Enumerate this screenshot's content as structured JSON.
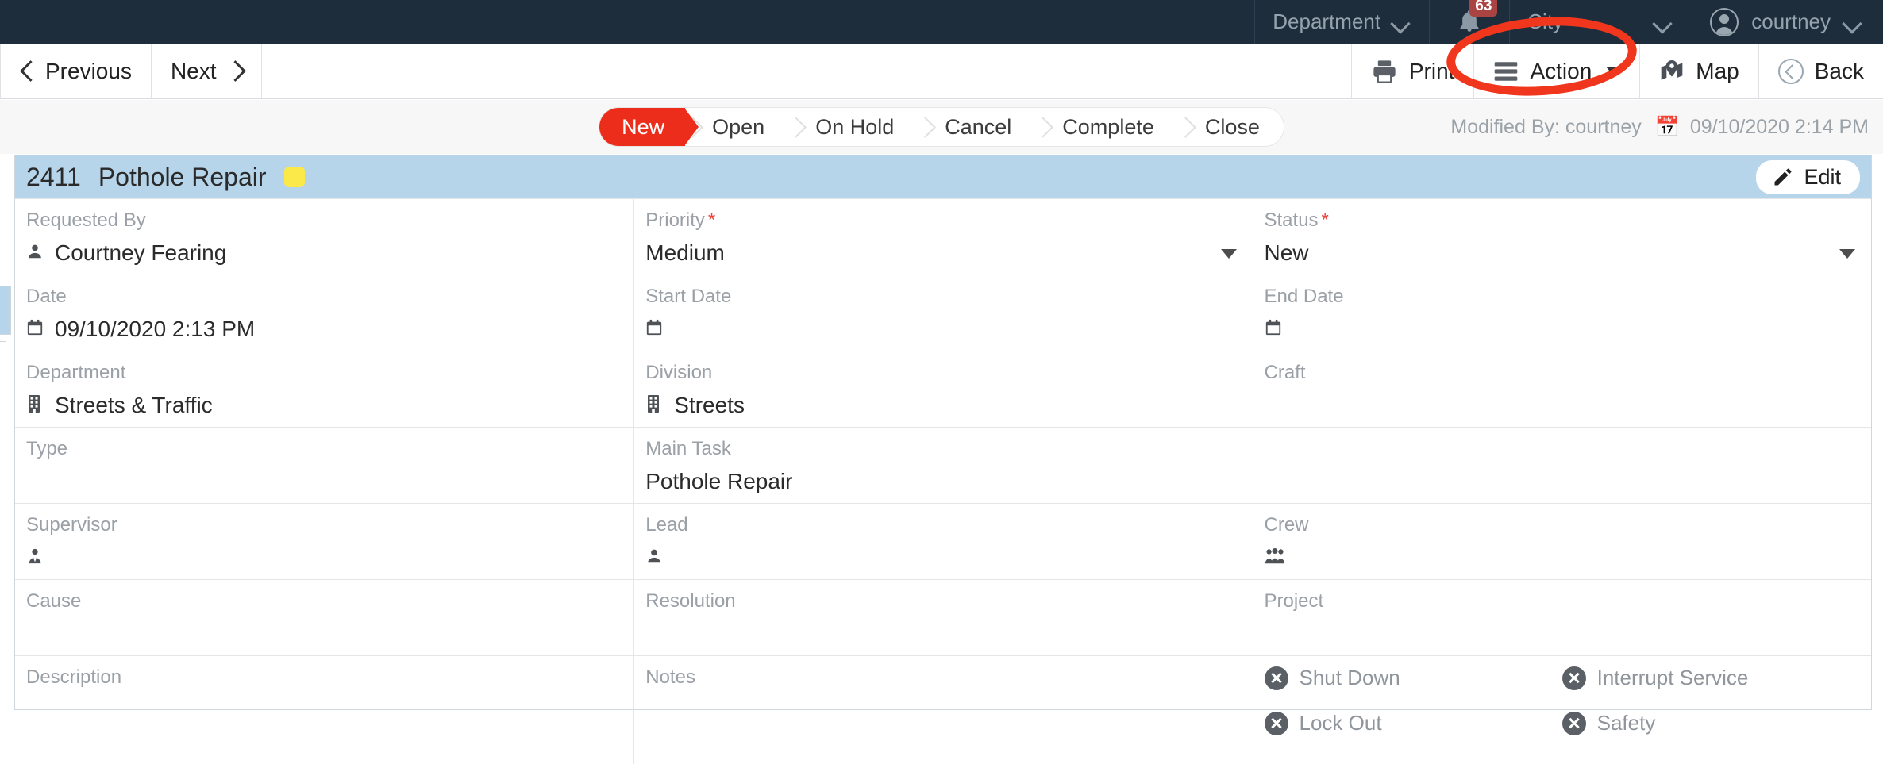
{
  "topbar": {
    "department_filter": "Department",
    "city_filter": "City",
    "notifications_count": "63",
    "username": "courtney"
  },
  "toolbar": {
    "previous_label": "Previous",
    "next_label": "Next",
    "print_label": "Print",
    "action_label": "Action",
    "map_label": "Map",
    "back_label": "Back"
  },
  "workflow": {
    "steps": [
      {
        "label": "New",
        "active": true
      },
      {
        "label": "Open",
        "active": false
      },
      {
        "label": "On Hold",
        "active": false
      },
      {
        "label": "Cancel",
        "active": false
      },
      {
        "label": "Complete",
        "active": false
      },
      {
        "label": "Close",
        "active": false
      }
    ],
    "active_color": "#ec2d1b"
  },
  "modified": {
    "prefix": "Modified By:",
    "user": "courtney",
    "datetime": "09/10/2020 2:14 PM"
  },
  "record": {
    "number": "2411",
    "title": "Pothole Repair",
    "flag_color": "#fbe94a",
    "header_color": "#b6d4ea",
    "edit_label": "Edit"
  },
  "fields": {
    "requested_by": {
      "label": "Requested By",
      "value": "Courtney Fearing",
      "required": false
    },
    "priority": {
      "label": "Priority",
      "value": "Medium",
      "required": true
    },
    "status": {
      "label": "Status",
      "value": "New",
      "required": true
    },
    "date": {
      "label": "Date",
      "value": "09/10/2020 2:13 PM",
      "required": false
    },
    "start_date": {
      "label": "Start Date",
      "value": "",
      "required": false
    },
    "end_date": {
      "label": "End Date",
      "value": "",
      "required": false
    },
    "department": {
      "label": "Department",
      "value": "Streets & Traffic",
      "required": false
    },
    "division": {
      "label": "Division",
      "value": "Streets",
      "required": false
    },
    "craft": {
      "label": "Craft",
      "value": "",
      "required": false
    },
    "type": {
      "label": "Type",
      "value": "",
      "required": false
    },
    "main_task": {
      "label": "Main Task",
      "value": "Pothole Repair",
      "required": false
    },
    "supervisor": {
      "label": "Supervisor",
      "value": "",
      "required": false
    },
    "lead": {
      "label": "Lead",
      "value": "",
      "required": false
    },
    "crew": {
      "label": "Crew",
      "value": "",
      "required": false
    },
    "cause": {
      "label": "Cause",
      "value": "",
      "required": false
    },
    "resolution": {
      "label": "Resolution",
      "value": "",
      "required": false
    },
    "project": {
      "label": "Project",
      "value": "",
      "required": false
    },
    "description": {
      "label": "Description",
      "value": "",
      "required": false
    },
    "notes": {
      "label": "Notes",
      "value": "",
      "required": false
    }
  },
  "checkboxes": [
    {
      "label": "Shut Down",
      "checked": false
    },
    {
      "label": "Interrupt Service",
      "checked": false
    },
    {
      "label": "Lock Out",
      "checked": false
    },
    {
      "label": "Safety",
      "checked": false
    }
  ],
  "annotation": {
    "target": "print-button",
    "color": "#f0361c"
  }
}
